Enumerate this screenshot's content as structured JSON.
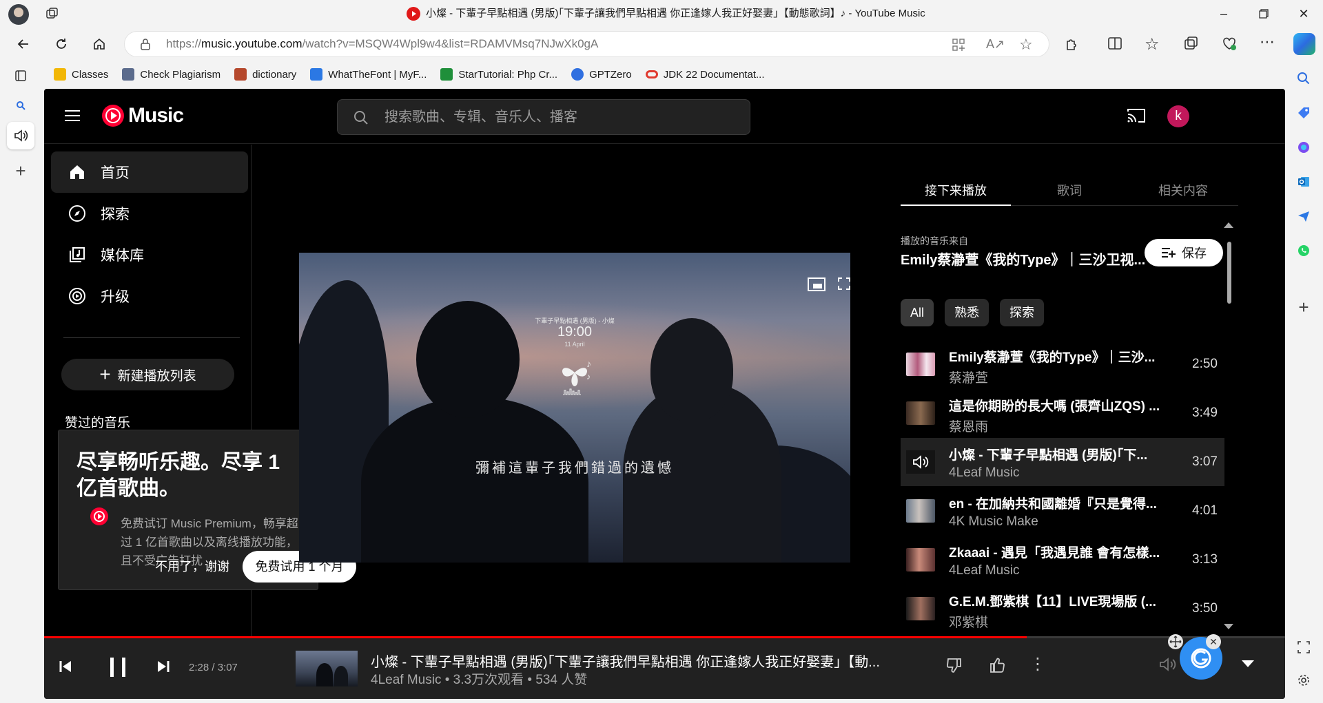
{
  "window": {
    "title": "小燦 - 下輩子早點相遇 (男版)｢下輩子讓我們早點相遇 你正逢嫁人我正好娶妻｣【動態歌詞】♪ - YouTube Music"
  },
  "address": {
    "url_prefix": "https://",
    "url_host": "music.youtube.com",
    "url_rest": "/watch?v=MSQW4Wpl9w4&list=RDAMVMsq7NJwXk0gA"
  },
  "bookmarks": [
    {
      "label": "Classes",
      "color": "#f2b705"
    },
    {
      "label": "Check Plagiarism",
      "color": "#5b6b8c"
    },
    {
      "label": "dictionary",
      "color": "#b5482c"
    },
    {
      "label": "WhatTheFont | MyF...",
      "color": "#2b78e4"
    },
    {
      "label": "StarTutorial: Php Cr...",
      "color": "#1f8f3a"
    },
    {
      "label": "GPTZero",
      "color": "#2f6fe0"
    },
    {
      "label": "JDK 22 Documentat...",
      "color": "#e03a2f"
    }
  ],
  "ytm": {
    "logo_text": "Music",
    "search_placeholder": "搜索歌曲、专辑、音乐人、播客",
    "user_initial": "k",
    "nav": [
      {
        "label": "首页",
        "icon": "home-icon",
        "active": true
      },
      {
        "label": "探索",
        "icon": "compass-icon",
        "active": false
      },
      {
        "label": "媒体库",
        "icon": "library-icon",
        "active": false
      },
      {
        "label": "升级",
        "icon": "upgrade-icon",
        "active": false
      }
    ],
    "new_playlist": "新建播放列表",
    "liked_music": "赞过的音乐",
    "promo": {
      "title": "尽享畅听乐趣。尽享 1 亿首歌曲。",
      "description": "免费试订 Music Premium，畅享超过 1 亿首歌曲以及离线播放功能，且不受广告打扰",
      "decline": "不用了，谢谢",
      "accept": "免费试用 1 个月"
    },
    "video": {
      "overlay_small": "下輩子早點相遇 (男版) - 小燦",
      "clock": "19:00",
      "date": "11 April",
      "lyric": "彌補這輩子我們錯過的遺憾"
    },
    "tabs": [
      {
        "label": "接下来播放",
        "active": true
      },
      {
        "label": "歌词",
        "active": false
      },
      {
        "label": "相关内容",
        "active": false
      }
    ],
    "queue_from_label": "播放的音乐来自",
    "queue_from_title": "Emily蔡瀞萱《我的Type》｜三沙卫视...",
    "save_label": "保存",
    "chips": [
      "All",
      "熟悉",
      "探索"
    ],
    "queue": [
      {
        "title": "Emily蔡瀞萱《我的Type》｜三沙...",
        "artist": "蔡瀞萱",
        "duration": "2:50",
        "playing": false
      },
      {
        "title": "這是你期盼的長大嗎 (張齊山ZQS) ...",
        "artist": "蔡恩雨",
        "duration": "3:49",
        "playing": false
      },
      {
        "title": "小燦 - 下輩子早點相遇 (男版)｢下...",
        "artist": "4Leaf Music",
        "duration": "3:07",
        "playing": true
      },
      {
        "title": "en - 在加納共和國離婚『只是覺得...",
        "artist": "4K Music Make",
        "duration": "4:01",
        "playing": false
      },
      {
        "title": "Zkaaai - 遇見「我遇見誰 會有怎樣...",
        "artist": "4Leaf Music",
        "duration": "3:13",
        "playing": false
      },
      {
        "title": "G.E.M.鄧紫棋【11】LIVE現場版 (...",
        "artist": "邓紫棋",
        "duration": "3:50",
        "playing": false
      }
    ],
    "player": {
      "time": "2:28 / 3:07",
      "progress": 0.7918,
      "title": "小燦 - 下輩子早點相遇 (男版)｢下輩子讓我們早點相遇 你正逢嫁人我正好娶妻｣【動...",
      "subtitle": "4Leaf Music • 3.3万次观看 • 534 人赞"
    }
  }
}
